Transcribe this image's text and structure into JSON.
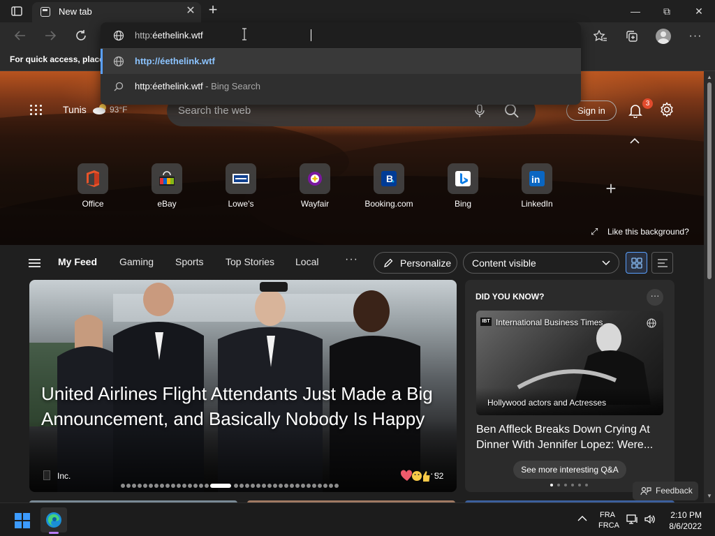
{
  "browser": {
    "tab_title": "New tab",
    "window_controls": {
      "minimize": "—",
      "restore": "⧉",
      "close": "✕"
    }
  },
  "favorites_bar": {
    "text": "For quick access, place y"
  },
  "omnibox": {
    "typed_prefix": "http:",
    "typed_rest": "éethelink.wtf",
    "suggestions": [
      {
        "text": "http://éethelink.wtf",
        "type": "url",
        "selected": true
      },
      {
        "text": "http:éethelink.wtf",
        "suffix": " - Bing Search",
        "type": "search"
      }
    ]
  },
  "hero": {
    "city": "Tunis",
    "temperature": "93°F",
    "search_placeholder": "Search the web",
    "sign_in": "Sign in",
    "notification_count": "3",
    "like_background": "Like this background?",
    "tiles": [
      {
        "label": "Office"
      },
      {
        "label": "eBay"
      },
      {
        "label": "Lowe's"
      },
      {
        "label": "Wayfair"
      },
      {
        "label": "Booking.com"
      },
      {
        "label": "Bing"
      },
      {
        "label": "LinkedIn"
      }
    ]
  },
  "feed_nav": {
    "items": [
      "My Feed",
      "Gaming",
      "Sports",
      "Top Stories",
      "Local"
    ],
    "more": "···",
    "personalize": "Personalize",
    "content_visibility": "Content visible"
  },
  "main_card": {
    "headline": "United Airlines Flight Attendants Just Made a Big Announcement, and Basically Nobody Is Happy",
    "source": "Inc.",
    "reaction_count": "52",
    "carousel_total": 36,
    "carousel_active": 16
  },
  "side_card": {
    "heading": "DID YOU KNOW?",
    "source": "International Business Times",
    "source_logo": "IBT",
    "image_tag": "Hollywood actors and Actresses",
    "title": "Ben Affleck Breaks Down Crying At Dinner With Jennifer Lopez: Were...",
    "cta": "See more interesting Q&A",
    "carousel_total": 6,
    "carousel_active": 0
  },
  "feedback": "Feedback",
  "taskbar": {
    "lang_line1": "FRA",
    "lang_line2": "FRCA",
    "time": "2:10 PM",
    "date": "8/6/2022"
  },
  "colors": {
    "accent": "#5aa0ff",
    "badge": "#e24b2d",
    "link": "#8cc4ff",
    "windows_blue": "#3c9bff"
  }
}
